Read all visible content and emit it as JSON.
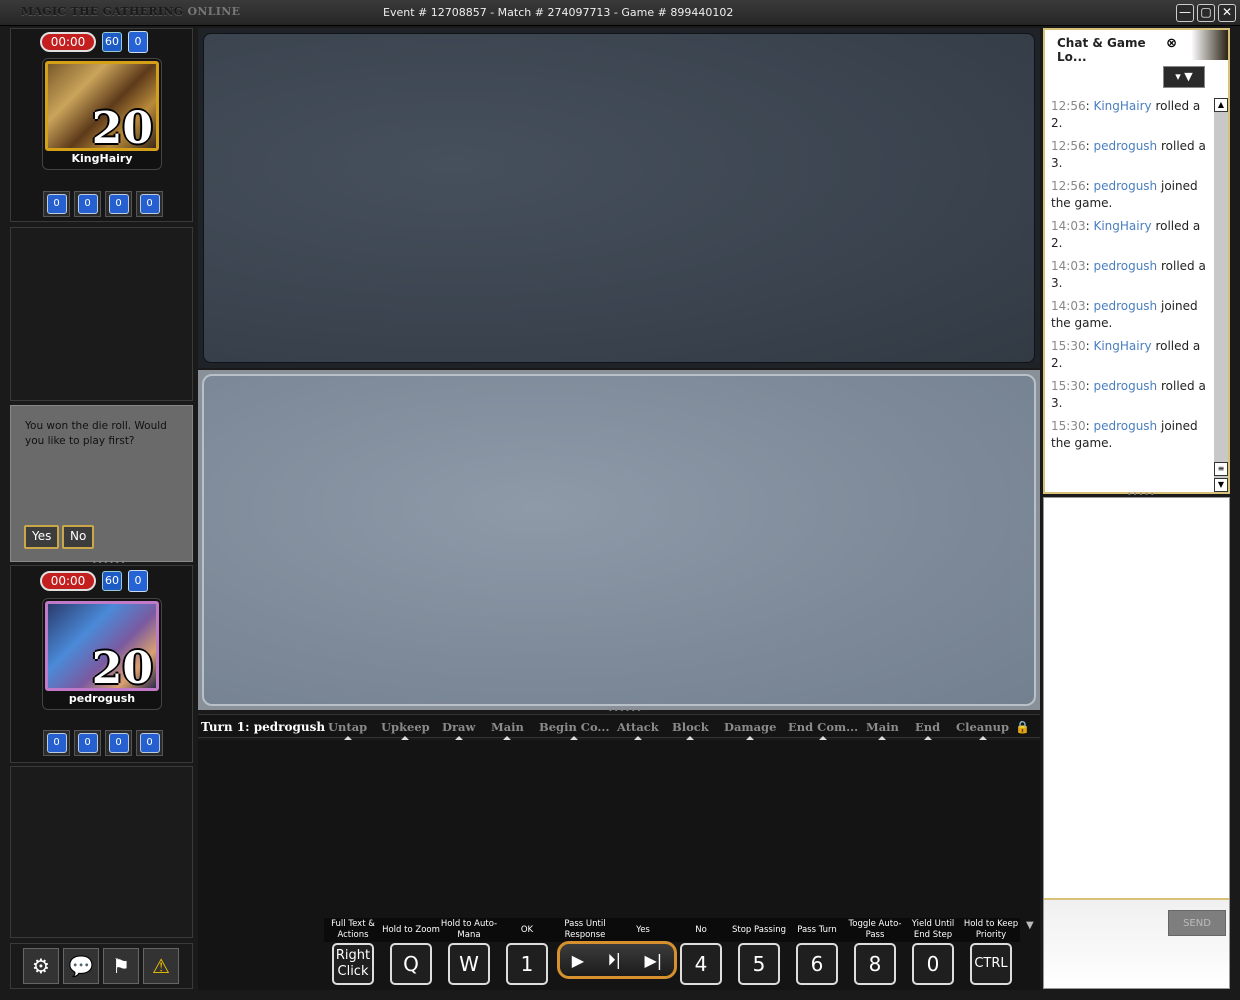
{
  "window": {
    "app_title_main": "MAGIC THE GATHERING",
    "app_title_suffix": "ONLINE",
    "event_info": "Event # 12708857 - Match # 274097713 - Game # 899440102",
    "minimize": "—",
    "maximize": "▢",
    "close": "✕"
  },
  "opponent": {
    "timer": "00:00",
    "deck_count": "60",
    "library": "0",
    "life": "20",
    "name": "KingHairy",
    "counters": [
      "0",
      "0",
      "0",
      "0"
    ]
  },
  "player": {
    "timer": "00:00",
    "deck_count": "60",
    "library": "0",
    "life": "20",
    "name": "pedrogush",
    "counters": [
      "0",
      "0",
      "0",
      "0"
    ]
  },
  "prompt": {
    "text": "You won the die roll. Would you like to play first?",
    "yes": "Yes",
    "no": "No"
  },
  "phasebar": {
    "turn": "Turn 1: pedrogush",
    "phases": [
      "Untap",
      "Upkeep",
      "Draw",
      "Main",
      "Begin Co...",
      "Attack",
      "Block",
      "Damage",
      "End Com...",
      "Main",
      "End",
      "Cleanup"
    ]
  },
  "hotkeys": [
    {
      "label": "Full Text & Actions",
      "key": "Right Click"
    },
    {
      "label": "Hold to Zoom",
      "key": "Q"
    },
    {
      "label": "Hold to Auto-Mana",
      "key": "W"
    },
    {
      "label": "OK",
      "key": "1"
    },
    {
      "label": "Pass Until Response",
      "key": ""
    },
    {
      "label": "Yes",
      "key": ""
    },
    {
      "label": "No",
      "key": "4"
    },
    {
      "label": "Stop Passing",
      "key": "5"
    },
    {
      "label": "Pass Turn",
      "key": "6"
    },
    {
      "label": "Toggle Auto-Pass",
      "key": "8"
    },
    {
      "label": "Yield Until End Step",
      "key": "0"
    },
    {
      "label": "Hold to Keep Priority",
      "key": "CTRL"
    }
  ],
  "chat": {
    "tab_label": "Chat & Game Lo...",
    "send": "SEND",
    "log": [
      {
        "time": "12:56",
        "user": "KingHairy",
        "msg": " rolled a 2."
      },
      {
        "time": "12:56",
        "user": "pedrogush",
        "msg": " rolled a 3."
      },
      {
        "time": "12:56",
        "user": "pedrogush",
        "msg": " joined the game."
      },
      {
        "time": "14:03",
        "user": "KingHairy",
        "msg": " rolled a 2."
      },
      {
        "time": "14:03",
        "user": "pedrogush",
        "msg": " rolled a 3."
      },
      {
        "time": "14:03",
        "user": "pedrogush",
        "msg": " joined the game."
      },
      {
        "time": "15:30",
        "user": "KingHairy",
        "msg": " rolled a 2."
      },
      {
        "time": "15:30",
        "user": "pedrogush",
        "msg": " rolled a 3."
      },
      {
        "time": "15:30",
        "user": "pedrogush",
        "msg": " joined the game."
      }
    ]
  },
  "icons": {
    "settings": "settings-gear-icon",
    "chat": "chat-bubble-icon",
    "concede": "concede-flag-icon",
    "warning": "warning-icon"
  },
  "colors": {
    "timer_red": "#c41f1f",
    "accent_gold": "#d6912e",
    "chat_user_blue": "#4a7ec0"
  }
}
